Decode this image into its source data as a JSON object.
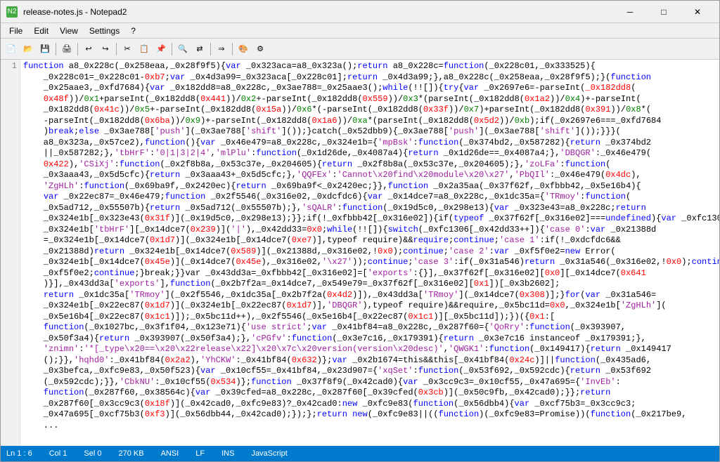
{
  "window": {
    "title": "release-notes.js - Notepad2",
    "icon": "N2"
  },
  "menu": {
    "items": [
      "File",
      "Edit",
      "View",
      "Settings",
      "?"
    ]
  },
  "statusbar": {
    "line": "Ln 1 : 6",
    "col": "Col 1",
    "sel": "Sel 0",
    "size": "270 KB",
    "encoding": "ANSI",
    "lineending": "LF",
    "ins": "INS",
    "language": "JavaScript"
  },
  "title_controls": {
    "minimize": "─",
    "maximize": "□",
    "close": "✕"
  }
}
